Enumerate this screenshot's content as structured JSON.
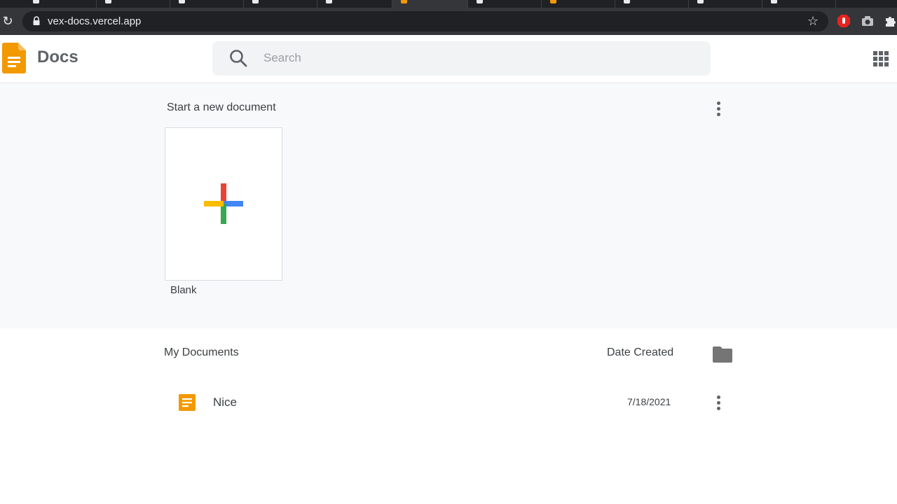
{
  "browser": {
    "url": "vex-docs.vercel.app",
    "tabs": [
      {
        "active": false,
        "favicon_color": "#e8eaed"
      },
      {
        "active": false,
        "favicon_color": "#e8eaed"
      },
      {
        "active": false,
        "favicon_color": "#e8eaed"
      },
      {
        "active": false,
        "favicon_color": "#e8eaed"
      },
      {
        "active": false,
        "favicon_color": "#e8eaed"
      },
      {
        "active": true,
        "favicon_color": "#f29900"
      },
      {
        "active": false,
        "favicon_color": "#e8eaed"
      },
      {
        "active": false,
        "favicon_color": "#f29900"
      },
      {
        "active": false,
        "favicon_color": "#e8eaed"
      },
      {
        "active": false,
        "favicon_color": "#e8eaed"
      },
      {
        "active": false,
        "favicon_color": "#e8eaed"
      }
    ],
    "icons": [
      "reload-icon",
      "lock-icon",
      "bookmark-star-icon",
      "adblock-extension-icon",
      "camera-extension-icon",
      "puzzle-extensions-icon"
    ]
  },
  "header": {
    "brand": "Docs",
    "search_placeholder": "Search",
    "brand_color": "#f29900"
  },
  "gallery": {
    "title": "Start a new document",
    "templates": [
      {
        "label": "Blank"
      }
    ],
    "plus_colors": {
      "top": "#ea4335",
      "right": "#4285f4",
      "bottom": "#34a853",
      "left": "#fbbc04"
    }
  },
  "documents": {
    "title": "My Documents",
    "date_header": "Date Created",
    "rows": [
      {
        "name": "Nice",
        "date": "7/18/2021"
      }
    ]
  }
}
